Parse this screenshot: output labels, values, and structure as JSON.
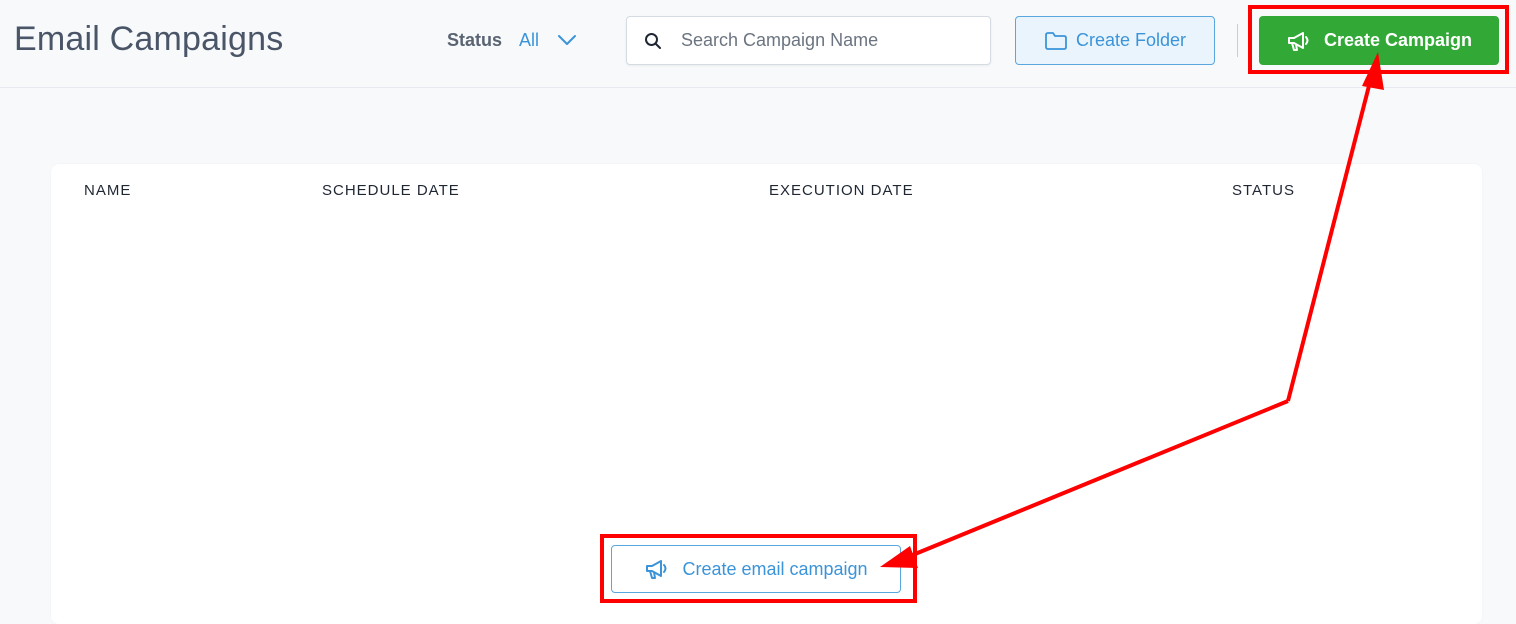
{
  "header": {
    "title": "Email Campaigns",
    "status_filter": {
      "label": "Status",
      "value": "All",
      "icon": "chevron-down-icon"
    },
    "search": {
      "placeholder": "Search Campaign Name",
      "value": "",
      "icon": "search-icon"
    },
    "create_folder": {
      "label": "Create Folder",
      "icon": "folder-icon"
    },
    "create_campaign": {
      "label": "Create Campaign",
      "icon": "megaphone-icon"
    }
  },
  "table": {
    "columns": [
      "NAME",
      "SCHEDULE DATE",
      "EXECUTION DATE",
      "STATUS"
    ],
    "rows": []
  },
  "empty_state": {
    "button_label": "Create email campaign",
    "icon": "megaphone-icon"
  },
  "colors": {
    "primary_green": "#32a836",
    "accent_blue": "#3b94d9",
    "annotation_red": "#ff0000",
    "background": "#f7f9fb"
  }
}
